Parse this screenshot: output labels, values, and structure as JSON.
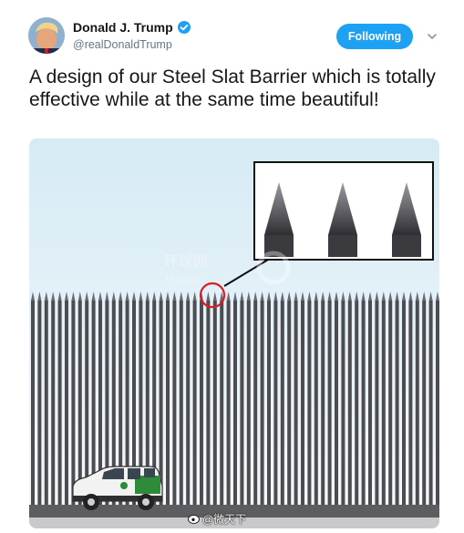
{
  "tweet": {
    "author_name": "Donald J. Trump",
    "author_handle": "@realDonaldTrump",
    "follow_label": "Following",
    "text": "A design of our Steel Slat Barrier which is totally effective while at the same time beautiful!"
  },
  "media": {
    "subject": "steel-slat-barrier illustration",
    "watermark_overlay": "环球网 Huanqiu",
    "bottom_watermark": "@微天下"
  },
  "icons": {
    "verified": "verified-badge-icon",
    "chevron": "chevron-down-icon",
    "weibo": "weibo-logo-icon"
  },
  "colors": {
    "follow_button": "#1da1f2",
    "sky_top": "#d8ecf6",
    "sky_bottom": "#f4f8fb",
    "slat": "#4c4c51",
    "highlight_circle": "#d81f26"
  }
}
